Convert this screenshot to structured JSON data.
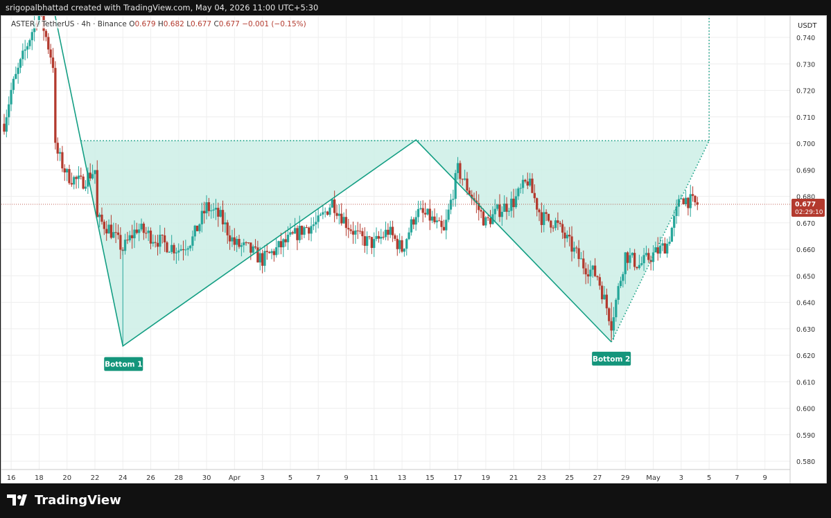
{
  "header": {
    "caption": "srigopalbhattad created with TradingView.com, May 04, 2026 11:00 UTC+5:30"
  },
  "legend": {
    "symbol": "ASTER / TetherUS · 4h · Binance",
    "o_label": "O",
    "o": "0.679",
    "h_label": "H",
    "h": "0.682",
    "l_label": "L",
    "l": "0.677",
    "c_label": "C",
    "c": "0.677",
    "change": "−0.001 (−0.15%)"
  },
  "price_axis": {
    "currency": "USDT",
    "last_price": "0.677",
    "countdown": "02:29:10"
  },
  "footer": {
    "brand": "TradingView"
  },
  "colors": {
    "up": "#26a69a",
    "down": "#b33a2e",
    "pattern": "#139e83",
    "pattern_fill": "#cdeee6",
    "label_bg": "#14957b"
  },
  "chart_data": {
    "type": "candlestick",
    "x_ticks": [
      "16",
      "18",
      "20",
      "22",
      "24",
      "26",
      "28",
      "30",
      "Apr",
      "3",
      "5",
      "7",
      "9",
      "11",
      "13",
      "15",
      "17",
      "19",
      "21",
      "23",
      "25",
      "27",
      "29",
      "May",
      "3",
      "5",
      "7",
      "9"
    ],
    "y_ticks": [
      "0.740",
      "0.730",
      "0.720",
      "0.710",
      "0.700",
      "0.690",
      "0.680",
      "0.670",
      "0.660",
      "0.650",
      "0.640",
      "0.630",
      "0.620",
      "0.610",
      "0.600",
      "0.590",
      "0.580"
    ],
    "ylim": [
      0.5768,
      0.7534
    ],
    "date_range": [
      "2026-03-15",
      "2026-05-09"
    ],
    "price_series": [
      [
        "2026-03-15",
        0.695
      ],
      [
        "2026-03-16",
        0.72
      ],
      [
        "2026-03-17",
        0.735
      ],
      [
        "2026-03-18",
        0.75
      ],
      [
        "2026-03-19",
        0.73
      ],
      [
        "2026-03-19",
        0.7
      ],
      [
        "2026-03-20",
        0.688
      ],
      [
        "2026-03-21",
        0.685
      ],
      [
        "2026-03-22",
        0.69
      ],
      [
        "2026-03-22",
        0.672
      ],
      [
        "2026-03-23",
        0.668
      ],
      [
        "2026-03-24",
        0.66
      ],
      [
        "2026-03-25",
        0.668
      ],
      [
        "2026-03-26",
        0.665
      ],
      [
        "2026-03-27",
        0.662
      ],
      [
        "2026-03-28",
        0.66
      ],
      [
        "2026-03-29",
        0.664
      ],
      [
        "2026-03-30",
        0.676
      ],
      [
        "2026-03-31",
        0.672
      ],
      [
        "2026-04-01",
        0.662
      ],
      [
        "2026-04-02",
        0.66
      ],
      [
        "2026-04-03",
        0.656
      ],
      [
        "2026-04-04",
        0.66
      ],
      [
        "2026-04-05",
        0.664
      ],
      [
        "2026-04-06",
        0.668
      ],
      [
        "2026-04-07",
        0.67
      ],
      [
        "2026-04-08",
        0.678
      ],
      [
        "2026-04-09",
        0.67
      ],
      [
        "2026-04-10",
        0.664
      ],
      [
        "2026-04-11",
        0.662
      ],
      [
        "2026-04-12",
        0.667
      ],
      [
        "2026-04-13",
        0.66
      ],
      [
        "2026-04-14",
        0.674
      ],
      [
        "2026-04-15",
        0.672
      ],
      [
        "2026-04-16",
        0.666
      ],
      [
        "2026-04-17",
        0.69
      ],
      [
        "2026-04-18",
        0.68
      ],
      [
        "2026-04-19",
        0.67
      ],
      [
        "2026-04-20",
        0.675
      ],
      [
        "2026-04-21",
        0.678
      ],
      [
        "2026-04-22",
        0.686
      ],
      [
        "2026-04-23",
        0.672
      ],
      [
        "2026-04-24",
        0.67
      ],
      [
        "2026-04-25",
        0.662
      ],
      [
        "2026-04-26",
        0.654
      ],
      [
        "2026-04-27",
        0.65
      ],
      [
        "2026-04-28",
        0.632
      ],
      [
        "2026-04-29",
        0.658
      ],
      [
        "2026-04-30",
        0.654
      ],
      [
        "2026-05-01",
        0.658
      ],
      [
        "2026-05-02",
        0.662
      ],
      [
        "2026-05-03",
        0.68
      ],
      [
        "2026-05-04",
        0.677
      ]
    ],
    "pattern": {
      "name": "double bottom",
      "points": [
        [
          "2026-03-21",
          0.701
        ],
        [
          "2026-03-24",
          0.6235
        ],
        [
          "2026-04-14",
          0.7013
        ],
        [
          "2026-04-28",
          0.625
        ],
        [
          "2026-05-05",
          0.701
        ],
        [
          "2026-05-05",
          0.752
        ]
      ],
      "labels": [
        "Bottom 1",
        "Bottom 2"
      ],
      "neckline": 0.701
    },
    "last_price_line": 0.677
  }
}
